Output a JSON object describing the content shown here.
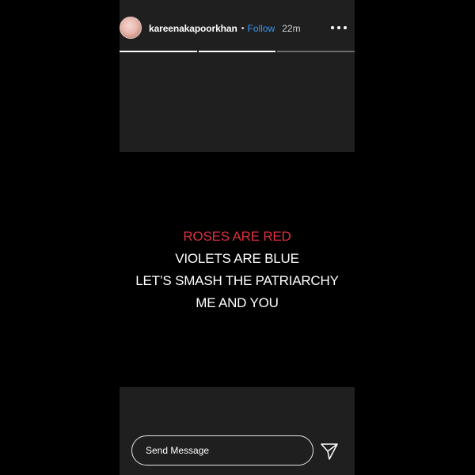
{
  "header": {
    "username": "kareenakapoorkhan",
    "separator": "•",
    "follow_label": "Follow",
    "time_ago": "22m",
    "avatar_icon": "profile-avatar",
    "more_icon": "more-options-icon"
  },
  "progress": {
    "segments": [
      1.0,
      1.0,
      0.0
    ]
  },
  "story": {
    "lines": [
      {
        "text": "ROSES ARE RED",
        "color": "#dc2f3b"
      },
      {
        "text": "VIOLETS ARE BLUE",
        "color": "#ffffff"
      },
      {
        "text": "LET’S SMASH THE PATRIARCHY",
        "color": "#ffffff"
      },
      {
        "text": "ME AND YOU",
        "color": "#ffffff"
      }
    ]
  },
  "composer": {
    "placeholder": "Send Message",
    "send_icon": "paper-plane-icon"
  },
  "colors": {
    "background": "#000000",
    "panel": "#1f1f1f",
    "accent": "#3897f0",
    "red_text": "#dc2f3b"
  }
}
